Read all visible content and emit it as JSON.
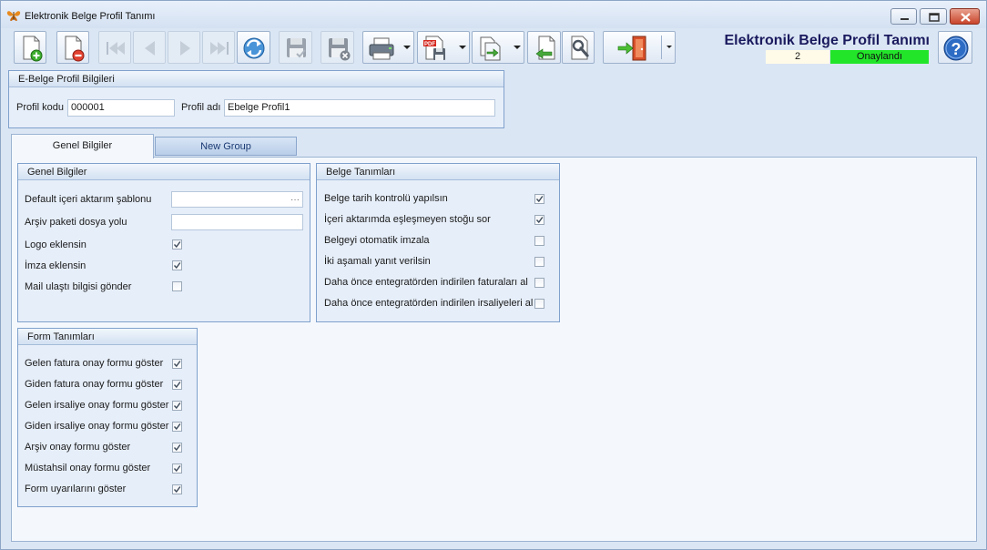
{
  "window": {
    "title": "Elektronik Belge Profil Tanımı"
  },
  "toolbar": {
    "buttons": [
      {
        "icon": "new-document-icon"
      },
      {
        "icon": "delete-document-icon"
      },
      {
        "icon": "first-record-icon"
      },
      {
        "icon": "previous-record-icon"
      },
      {
        "icon": "next-record-icon"
      },
      {
        "icon": "last-record-icon"
      },
      {
        "icon": "refresh-icon"
      },
      {
        "icon": "save-icon"
      },
      {
        "icon": "save-cancel-icon"
      },
      {
        "icon": "print-icon"
      },
      {
        "icon": "pdf-save-icon"
      },
      {
        "icon": "export-icon"
      },
      {
        "icon": "import-icon"
      },
      {
        "icon": "tools-icon"
      },
      {
        "icon": "exit-icon"
      },
      {
        "icon": "help-icon"
      }
    ]
  },
  "header": {
    "title": "Elektronik Belge Profil Tanımı",
    "record_number": "2",
    "status": "Onaylandı",
    "status_color": "#22e52a"
  },
  "profile_box": {
    "title": "E-Belge Profil Bilgileri",
    "code_label": "Profil kodu",
    "code_value": "000001",
    "name_label": "Profil adı",
    "name_value": "Ebelge Profil1"
  },
  "tabs": [
    {
      "label": "Genel Bilgiler",
      "active": true
    },
    {
      "label": "New Group",
      "active": false
    }
  ],
  "general_box": {
    "title": "Genel Bilgiler",
    "template_label": "Default içeri aktarım şablonu",
    "template_value": "",
    "ellipsis": "···",
    "archive_label": "Arşiv paketi dosya yolu",
    "archive_value": "",
    "checks": [
      {
        "label": "Logo eklensin",
        "checked": true
      },
      {
        "label": "İmza eklensin",
        "checked": true
      },
      {
        "label": "Mail ulaştı bilgisi gönder",
        "checked": false
      }
    ]
  },
  "document_box": {
    "title": "Belge Tanımları",
    "checks": [
      {
        "label": "Belge tarih kontrolü yapılsın",
        "checked": true
      },
      {
        "label": "İçeri aktarımda eşleşmeyen stoğu sor",
        "checked": true
      },
      {
        "label": "Belgeyi otomatik imzala",
        "checked": false
      },
      {
        "label": "İki aşamalı yanıt verilsin",
        "checked": false
      },
      {
        "label": "Daha önce entegratörden indirilen faturaları al",
        "checked": false
      },
      {
        "label": "Daha önce entegratörden indirilen irsaliyeleri al",
        "checked": false
      }
    ]
  },
  "form_box": {
    "title": "Form Tanımları",
    "checks": [
      {
        "label": "Gelen fatura onay formu göster",
        "checked": true
      },
      {
        "label": "Giden fatura onay formu göster",
        "checked": true
      },
      {
        "label": "Gelen irsaliye onay formu göster",
        "checked": true
      },
      {
        "label": "Giden irsaliye onay formu göster",
        "checked": true
      },
      {
        "label": "Arşiv onay formu göster",
        "checked": true
      },
      {
        "label": "Müstahsil onay formu göster",
        "checked": true
      },
      {
        "label": "Form uyarılarını göster",
        "checked": true
      }
    ]
  }
}
